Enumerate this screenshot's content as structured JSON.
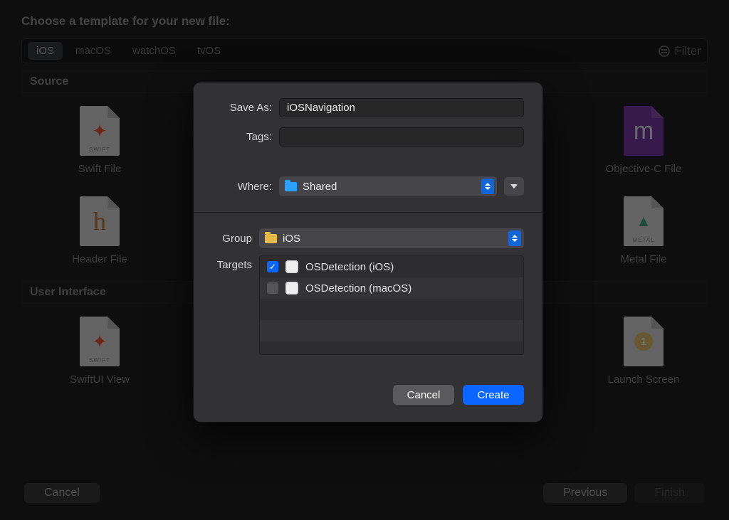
{
  "background": {
    "title": "Choose a template for your new file:",
    "platforms": [
      "iOS",
      "macOS",
      "watchOS",
      "tvOS"
    ],
    "selected_platform": 0,
    "filter_placeholder": "Filter",
    "sections": [
      {
        "name": "Source",
        "items": [
          {
            "label": "Swift File",
            "kind": "swift"
          },
          {
            "label": "Objective-C File",
            "kind": "m-purple",
            "glyph": "m"
          },
          {
            "label": "Header File",
            "kind": "h",
            "glyph": "h"
          },
          {
            "label": "Metal File",
            "kind": "metal",
            "tag": "METAL"
          }
        ]
      },
      {
        "name": "User Interface",
        "items": [
          {
            "label": "SwiftUI View",
            "kind": "swift"
          },
          {
            "label": "Launch Screen",
            "kind": "launch",
            "glyph": "1"
          }
        ]
      }
    ],
    "buttons": {
      "cancel": "Cancel",
      "previous": "Previous",
      "finish": "Finish"
    }
  },
  "sheet": {
    "save_as_label": "Save As:",
    "save_as_value": "iOSNavigation",
    "tags_label": "Tags:",
    "tags_value": "",
    "where_label": "Where:",
    "where_value": "Shared",
    "group_label": "Group",
    "group_value": "iOS",
    "targets_label": "Targets",
    "targets": [
      {
        "checked": true,
        "name": "OSDetection (iOS)"
      },
      {
        "checked": false,
        "name": "OSDetection (macOS)"
      }
    ],
    "buttons": {
      "cancel": "Cancel",
      "create": "Create"
    }
  }
}
